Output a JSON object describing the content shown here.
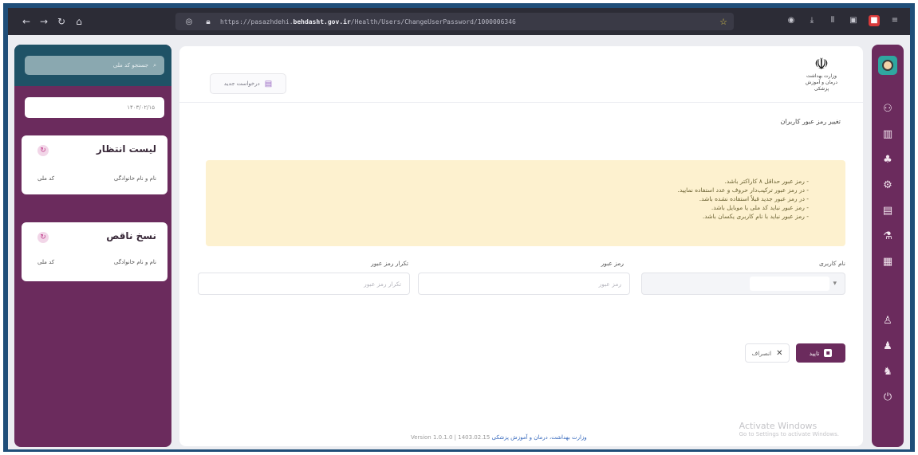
{
  "browser": {
    "url_prefix": "https://pasazhdehi.",
    "url_domain": "behdasht.gov.ir",
    "url_suffix": "/Health/Users/ChangeUserPassword/1000006346"
  },
  "sidebar_left": {
    "search_placeholder": "جستجو کد ملی",
    "date": "۱۴۰۳/۰۲/۱۵",
    "lists": [
      {
        "title": "لیست انتظار",
        "col_name": "نام و نام خانوادگی",
        "col_code": "کد ملی"
      },
      {
        "title": "نسخ ناقص",
        "col_name": "نام و نام خانوادگی",
        "col_code": "کد ملی"
      }
    ]
  },
  "main": {
    "request_button": "درخواست جدید",
    "logo_text_line1": "وزارت بهداشت",
    "logo_text_line2": "درمان و آموزش پزشکی",
    "page_title": "تغییر رمز عبور کاربران",
    "rules": [
      "رمز عبور حداقل ۸ کاراکتر باشد.",
      "در رمز عبور ترکیب‌دار حروف و عدد استفاده نمایید.",
      "در رمز عبور جدید قبلاً استفاده نشده باشد.",
      "رمز عبور نباید کد ملی یا موبایل باشد.",
      "رمز عبور نباید با نام کاربری یکسان باشد."
    ],
    "fields": {
      "username_label": "نام کاربری",
      "password_label": "رمز عبور",
      "password_placeholder": "رمز عبور",
      "confirm_label": "تکرار رمز عبور",
      "confirm_placeholder": "تکرار رمز عبور"
    },
    "confirm_button": "تایید",
    "cancel_button": "انصراف",
    "footer_link": "وزارت بهداشت، درمان و آموزش پزشکی",
    "footer_version": "Version 1.0.1.0 | 1403.02.15",
    "watermark_title": "Activate Windows",
    "watermark_sub": "Go to Settings to activate Windows."
  }
}
